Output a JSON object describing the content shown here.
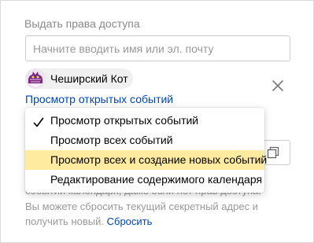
{
  "access": {
    "title": "Выдать права доступа",
    "search_placeholder": "Начните вводить имя или эл. почту"
  },
  "user": {
    "name": "Чеширский Кот",
    "permission_link": "Просмотр открытых событий"
  },
  "dropdown": {
    "items": [
      {
        "label": "Просмотр открытых событий",
        "checked": true
      },
      {
        "label": "Просмотр всех событий",
        "checked": false
      },
      {
        "label": "Просмотр всех и создание новых событий",
        "checked": false,
        "highlighted": true
      },
      {
        "label": "Редактирование содержимого календаря",
        "checked": false
      }
    ]
  },
  "secret": {
    "hint_partial": "событий календаря, даже если нет прав доступа.",
    "hint_text": "Вы можете сбросить текущий секретный адрес и получить новый.",
    "reset_label": "Сбросить"
  },
  "colors": {
    "link": "#0044bb",
    "highlight": "#ffeba0",
    "muted_text": "#999999"
  }
}
